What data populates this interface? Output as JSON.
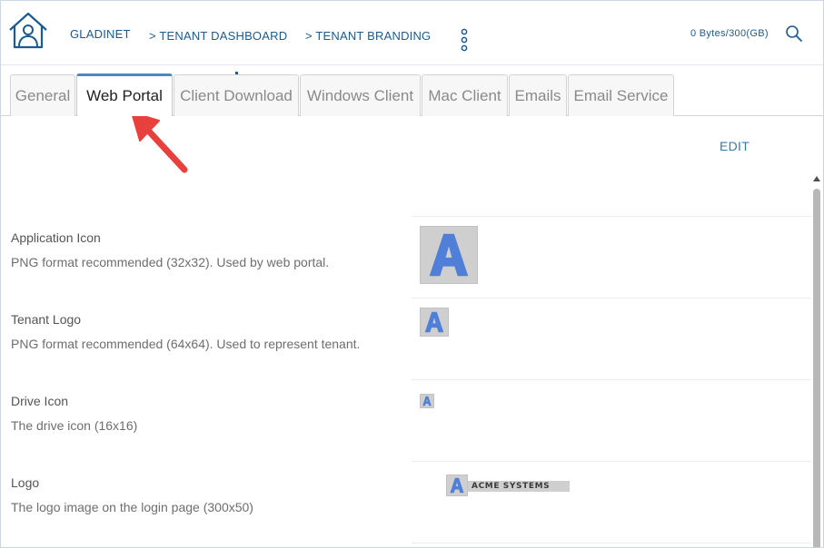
{
  "header": {
    "brand": "GLADINET",
    "breadcrumbs": [
      "> TENANT DASHBOARD",
      "> TENANT BRANDING"
    ],
    "storage": "0 Bytes/300(GB)"
  },
  "tabs": [
    "General",
    "Web Portal",
    "Client Download",
    "Windows Client",
    "Mac Client",
    "Emails",
    "Email Service"
  ],
  "active_tab": "Web Portal",
  "edit_label": "EDIT",
  "rows": [
    {
      "label": "Application Icon",
      "desc": "PNG format recommended (32x32). Used by web portal."
    },
    {
      "label": "Tenant Logo",
      "desc": "PNG format recommended (64x64). Used to represent tenant."
    },
    {
      "label": "Drive Icon",
      "desc": "The drive icon (16x16)"
    },
    {
      "label": "Logo",
      "desc": "The logo image on the login page (300x50)"
    }
  ],
  "logo_image_text": "ACME SYSTEMS",
  "colors": {
    "accent": "#1b5b8f",
    "tab_highlight": "#4a88c2",
    "arrow": "#e8403c",
    "letter_blue": "#4f7fd6"
  }
}
